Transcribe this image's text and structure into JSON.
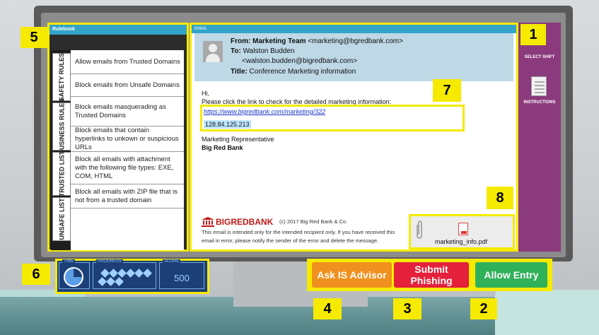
{
  "rulebook": {
    "title": "Rulebook",
    "tabs": [
      "SAFETY RULES",
      "BUSINESS RULES",
      "TRUSTED LIST",
      "UNSAFE LIST"
    ],
    "rules": [
      "Allow emails from Trusted Domains",
      "Block emails from Unsafe Domains",
      "Block emails masquerading as Trusted Domains",
      "Block emails that contain hyperlinks to unkown or suspicious URLs",
      "Block all emails with attachment with the following file types: EXE, COM, HTML",
      "Block all emails with ZIP file that is not from a trusted domain"
    ]
  },
  "email": {
    "header": "EMAIL",
    "from_label": "From:",
    "from_name": "Marketing Team",
    "from_address": "<marketing@bgredbank.com>",
    "to_label": "To:",
    "to_name": "Walston Budden",
    "to_address": "<walston.budden@bigredbank.com>",
    "title_label": "Title:",
    "title_value": "Conference Marketing information",
    "greeting": "Hi,",
    "body_line": "Please click the link to check for the detailed marketing information:",
    "link": "https://www.bigredbank.com/marketing/322",
    "ip": "128.84.125.213",
    "signature_role": "Marketing Representative",
    "signature_org": "Big Red Bank",
    "logo": "BIGREDBANK",
    "copyright": "(c) 2017 Big Red Bank & Co.",
    "disclaimer_1": "This email is intended only for the intended recipient only. If you have received this",
    "disclaimer_2": "email in error, please notify the sender of the error and delete the message.",
    "attachment": "marketing_info.pdf"
  },
  "sidebar": {
    "select_shift": "SELECT SHIFT",
    "instructions": "INSTRUCTIONS"
  },
  "hud": {
    "time_label": "TIME",
    "progress_label": "PROGRESS",
    "score_label": "SCORE",
    "score": "500",
    "time_remaining_fraction": 0.75
  },
  "actions": {
    "ask": "Ask IS Advisor",
    "submit": "Submit Phishing",
    "allow": "Allow Entry"
  },
  "callouts": [
    "1",
    "2",
    "3",
    "4",
    "5",
    "6",
    "7",
    "8"
  ],
  "colors": {
    "highlight": "#f5ea00",
    "ask": "#f0901e",
    "submit": "#e4203a",
    "allow": "#2fb15a",
    "header": "#33a3c8",
    "sidebar": "#8b3a7d"
  }
}
